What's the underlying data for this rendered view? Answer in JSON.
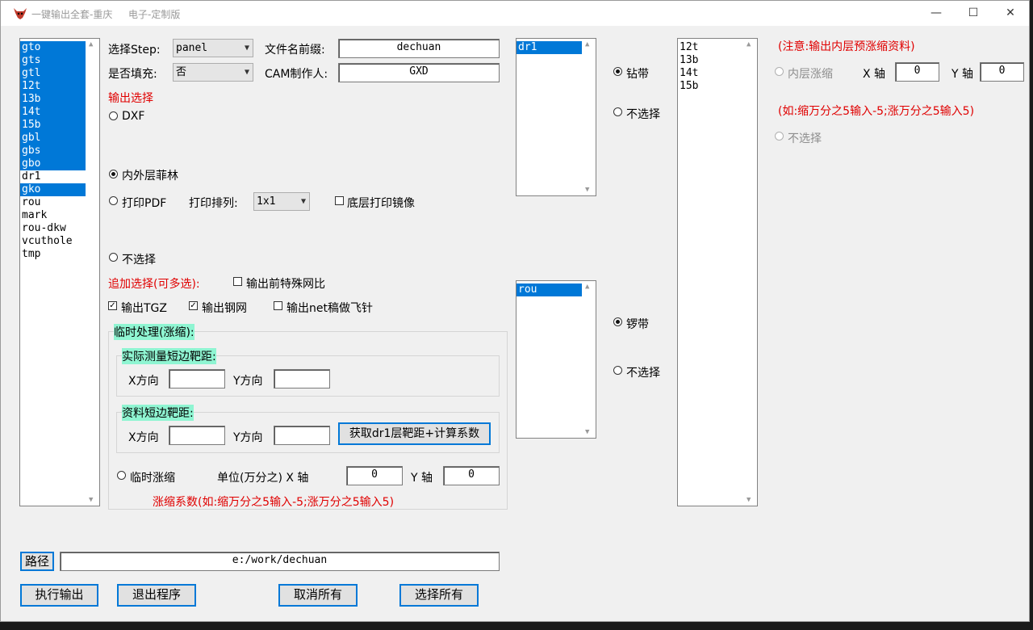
{
  "window": {
    "title": "一键输出全套-重庆",
    "title_suffix": "电子-定制版"
  },
  "layers_list": {
    "items": [
      {
        "name": "gto",
        "selected": true
      },
      {
        "name": "gts",
        "selected": true
      },
      {
        "name": "gtl",
        "selected": true
      },
      {
        "name": "12t",
        "selected": true
      },
      {
        "name": "13b",
        "selected": true
      },
      {
        "name": "14t",
        "selected": true
      },
      {
        "name": "15b",
        "selected": true
      },
      {
        "name": "gbl",
        "selected": true
      },
      {
        "name": "gbs",
        "selected": true
      },
      {
        "name": "gbo",
        "selected": true
      },
      {
        "name": "dr1",
        "selected": false
      },
      {
        "name": "gko",
        "selected": true
      },
      {
        "name": "rou",
        "selected": false
      },
      {
        "name": "mark",
        "selected": false
      },
      {
        "name": "rou-dkw",
        "selected": false
      },
      {
        "name": "vcuthole",
        "selected": false
      },
      {
        "name": "tmp",
        "selected": false
      }
    ]
  },
  "form": {
    "step_label": "选择Step:",
    "step_value": "panel",
    "fill_label": "是否填充:",
    "fill_value": "否",
    "prefix_label": "文件名前缀:",
    "prefix_value": "dechuan",
    "cam_label": "CAM制作人:",
    "cam_value": "GXD"
  },
  "output": {
    "heading": "输出选择",
    "dxf": "DXF",
    "inner_outer": "内外层菲林",
    "print_pdf": "打印PDF",
    "print_layout_label": "打印排列:",
    "print_layout_value": "1x1",
    "mirror_bottom": "底层打印镜像",
    "none": "不选择"
  },
  "extra": {
    "heading": "追加选择(可多选):",
    "special_net": "输出前特殊网比",
    "tgz": "输出TGZ",
    "stencil": "输出钢网",
    "net_flying": "输出net稿做飞针"
  },
  "temp": {
    "heading": "临时处理(涨缩):",
    "measured_heading": "实际测量短边靶距:",
    "x_dir": "X方向",
    "y_dir": "Y方向",
    "data_heading": "资料短边靶距:",
    "get_button": "获取dr1层靶距+计算系数",
    "temp_scale": "临时涨缩",
    "unit_label": "单位(万分之) X 轴",
    "y_axis": "Y 轴",
    "x_value": "0",
    "y_value": "0",
    "hint": "涨缩系数(如:缩万分之5输入-5;涨万分之5输入5)"
  },
  "drill": {
    "list_items": [
      "dr1"
    ],
    "drill_with": "钻带",
    "none": "不选择"
  },
  "rout": {
    "list_items": [
      "rou"
    ],
    "rout_with": "锣带",
    "none": "不选择"
  },
  "inner_list": {
    "items": [
      "12t",
      "13b",
      "14t",
      "15b"
    ]
  },
  "inner_scale": {
    "note": "(注意:输出内层预涨缩资料)",
    "label": "内层涨缩",
    "x_axis": "X 轴",
    "y_axis": "Y 轴",
    "x_value": "0",
    "y_value": "0",
    "hint": "(如:缩万分之5输入-5;涨万分之5输入5)",
    "none": "不选择"
  },
  "path": {
    "button": "路径",
    "value": "e:/work/dechuan"
  },
  "buttons": {
    "execute": "执行输出",
    "exit": "退出程序",
    "cancel_all": "取消所有",
    "select_all": "选择所有"
  },
  "colors": {
    "accent": "#0078d7",
    "heading_red": "#e00000",
    "highlight": "#8ff5d2"
  }
}
